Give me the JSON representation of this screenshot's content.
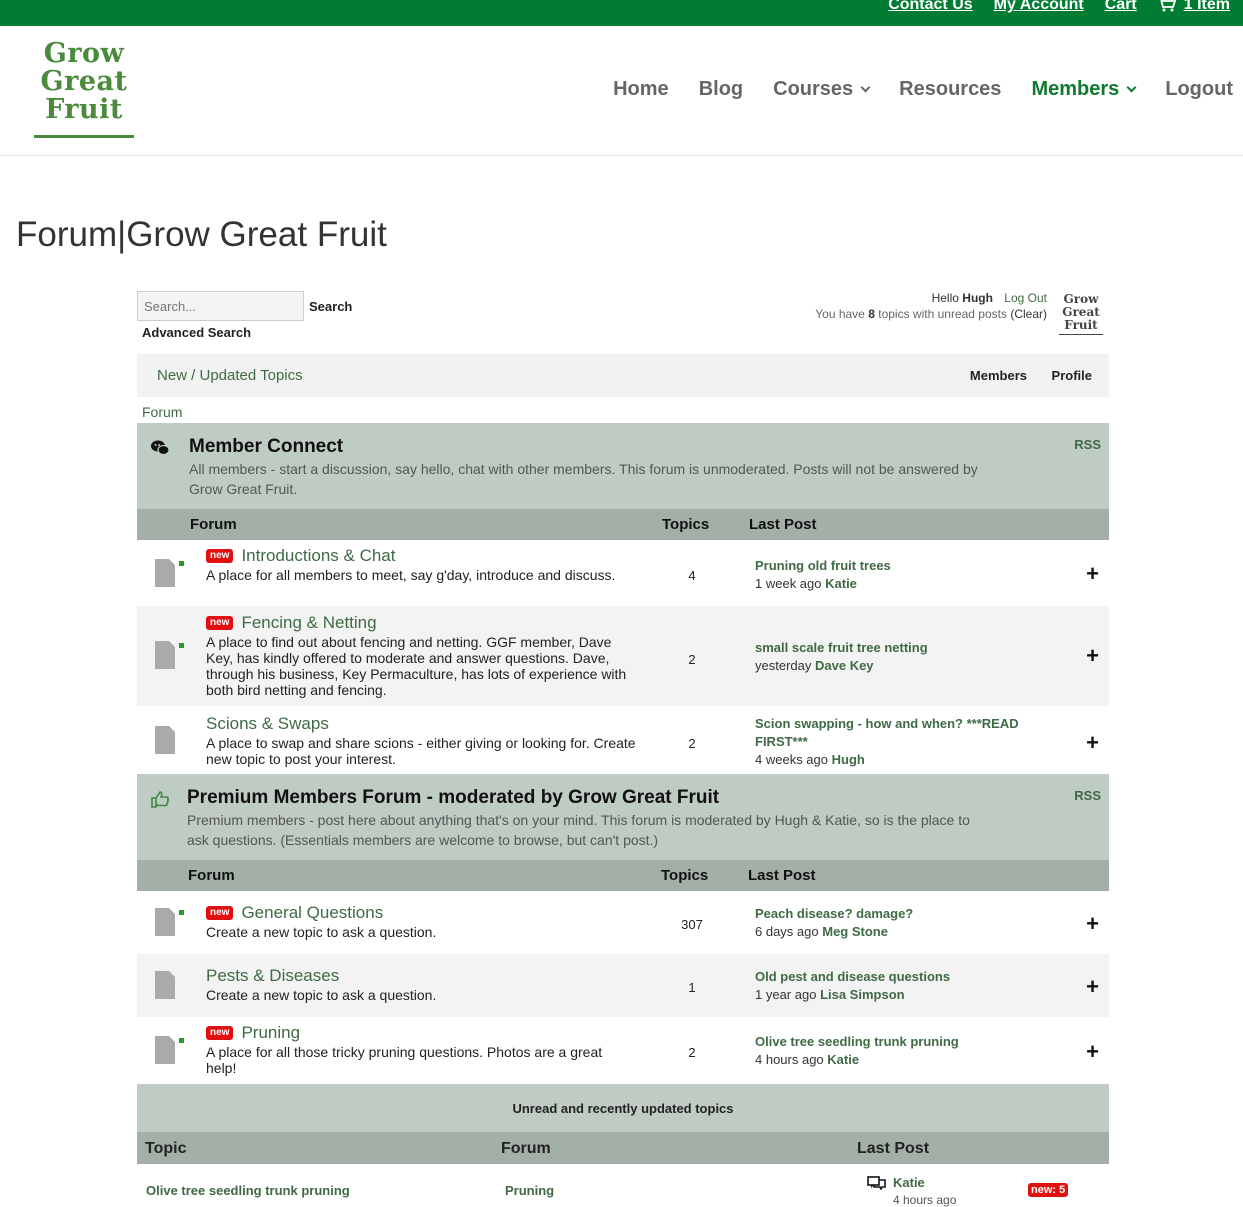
{
  "topbar": {
    "contact": "Contact Us",
    "account": "My Account",
    "cart": "Cart",
    "items": "1 Item"
  },
  "logo": {
    "line1": "Grow",
    "line2": "Great",
    "line3": "Fruit"
  },
  "nav": {
    "home": "Home",
    "blog": "Blog",
    "courses": "Courses",
    "resources": "Resources",
    "members": "Members",
    "logout": "Logout"
  },
  "page_title": "Forum|Grow Great Fruit",
  "search": {
    "placeholder": "Search...",
    "button": "Search",
    "advanced": "Advanced Search"
  },
  "user": {
    "hello": "Hello",
    "name": "Hugh",
    "logout": "Log Out",
    "unread_prefix": "You have",
    "unread_count": "8",
    "unread_suffix": "topics with unread posts",
    "clear": "(Clear)"
  },
  "toolbar": {
    "new_updated": "New / Updated Topics",
    "members": "Members",
    "profile": "Profile"
  },
  "breadcrumb": "Forum",
  "categories": [
    {
      "title": "Member Connect",
      "desc": "All members - start a discussion, say hello, chat with other members. This forum is unmoderated. Posts will not be answered by Grow Great Fruit.",
      "rss": "RSS",
      "col_forum": "Forum",
      "col_topics": "Topics",
      "col_last": "Last Post",
      "forums": [
        {
          "badge": "new",
          "title": "Introductions & Chat",
          "desc": "A place for all members to meet, say g'day, introduce and discuss.",
          "topics": "4",
          "last_title": "Pruning old fruit trees",
          "last_when": "1 week ago",
          "last_user": "Katie"
        },
        {
          "badge": "new",
          "title": "Fencing & Netting",
          "desc": "A place to find out about fencing and netting. GGF member, Dave Key, has kindly offered to moderate and answer questions. Dave, through his business, Key Permaculture, has lots of experience with both bird netting and fencing.",
          "topics": "2",
          "last_title": "small scale fruit tree netting",
          "last_when": "yesterday",
          "last_user": "Dave Key"
        },
        {
          "badge": "",
          "title": "Scions & Swaps",
          "desc": "A place to swap and share scions - either giving or looking for. Create new topic to post your interest.",
          "topics": "2",
          "last_title": "Scion swapping - how and when? ***READ FIRST***",
          "last_when": "4 weeks ago",
          "last_user": "Hugh"
        }
      ]
    },
    {
      "title": "Premium Members Forum - moderated by Grow Great Fruit",
      "desc": "Premium members - post here about anything that's on your mind. This forum is moderated by Hugh & Katie, so is the place to ask questions. (Essentials members are welcome to browse, but can't post.)",
      "rss": "RSS",
      "col_forum": "Forum",
      "col_topics": "Topics",
      "col_last": "Last Post",
      "forums": [
        {
          "badge": "new",
          "title": "General Questions",
          "desc": "Create a new topic to ask a question.",
          "topics": "307",
          "last_title": "Peach disease? damage?",
          "last_when": "6 days ago",
          "last_user": "Meg Stone"
        },
        {
          "badge": "",
          "title": "Pests & Diseases",
          "desc": "Create a new topic to ask a question.",
          "topics": "1",
          "last_title": "Old pest and disease questions",
          "last_when": "1 year ago",
          "last_user": "Lisa Simpson"
        },
        {
          "badge": "new",
          "title": "Pruning",
          "desc": "A place for all those tricky pruning questions. Photos are a great help!",
          "topics": "2",
          "last_title": "Olive tree seedling trunk pruning",
          "last_when": "4 hours ago",
          "last_user": "Katie"
        }
      ]
    }
  ],
  "unread": {
    "heading": "Unread and recently updated topics",
    "col_topic": "Topic",
    "col_forum": "Forum",
    "col_last": "Last Post",
    "rows": [
      {
        "topic": "Olive tree seedling trunk pruning",
        "forum": "Pruning",
        "user": "Katie",
        "when": "4 hours ago",
        "badge": "new: 5"
      }
    ]
  },
  "colors": {
    "brand_green": "#007d32",
    "category_bg": "#bfccc3",
    "header_bg": "#a3b0a7",
    "link_green": "#3f6a45",
    "new_red": "#e01010"
  }
}
